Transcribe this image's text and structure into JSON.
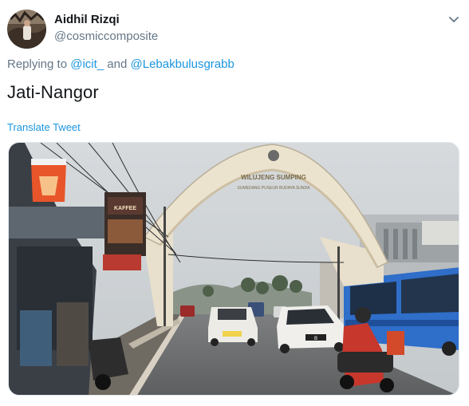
{
  "tweet": {
    "author_name": "Aidhil Rizqi",
    "author_handle": "@cosmiccomposite",
    "replying_prefix": "Replying to ",
    "reply_to_1": "@icit_",
    "reply_and": " and ",
    "reply_to_2": "@Lebakbulusgrabb",
    "text": "Jati-Nangor",
    "translate_label": "Translate Tweet"
  },
  "photo": {
    "arch_text_line1": "WILUJENG SUMPING",
    "arch_text_line2": "SUMEDANG PUSEUR BUDAYA SUNDA",
    "shop_sign": "KAFFEE",
    "plate_text": "B"
  },
  "icons": {
    "more": "chevron-down-icon",
    "avatar": "avatar-photo"
  },
  "colors": {
    "link": "#1b95e0",
    "secondary_text": "#657786",
    "primary_text": "#14171a"
  }
}
